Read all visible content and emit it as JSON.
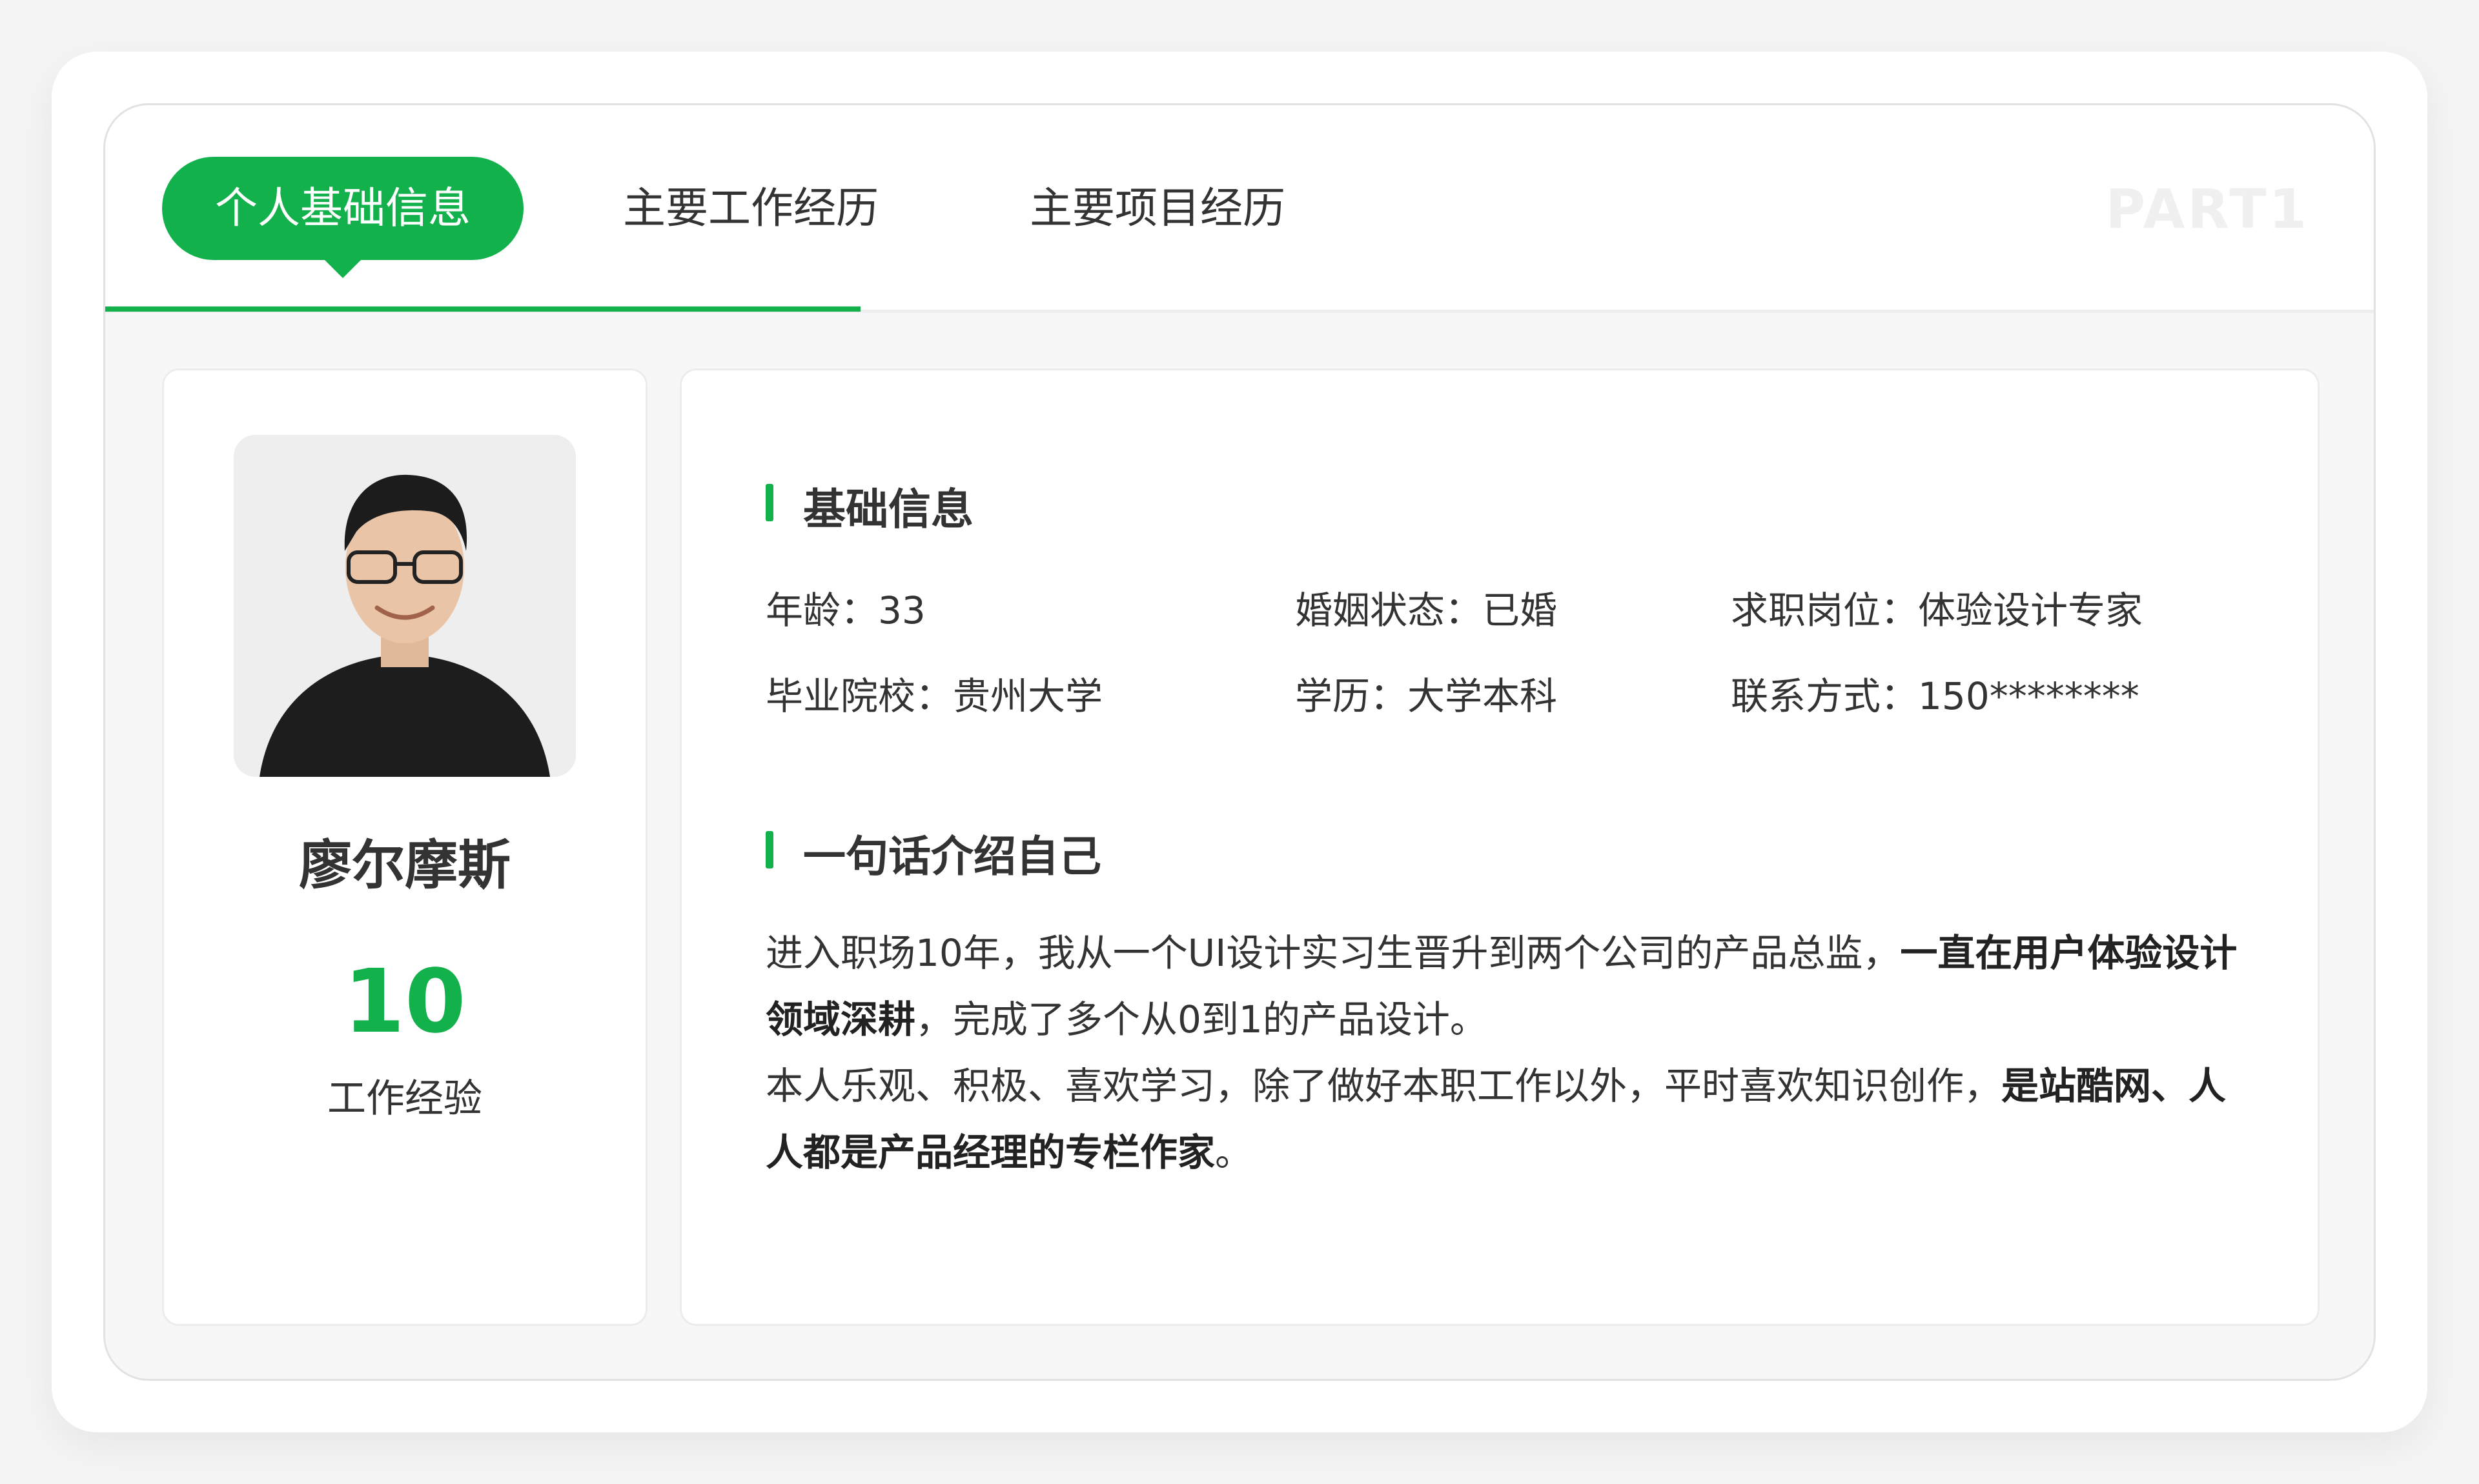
{
  "tabs": [
    {
      "label": "个人基础信息",
      "active": true
    },
    {
      "label": "主要工作经历",
      "active": false
    },
    {
      "label": "主要项目经历",
      "active": false
    }
  ],
  "part_label": "PART1",
  "profile": {
    "name": "廖尔摩斯",
    "years": "10",
    "years_label": "工作经验"
  },
  "basic_info": {
    "title": "基础信息",
    "items": [
      {
        "label": "年龄：",
        "value": "33"
      },
      {
        "label": "婚姻状态：",
        "value": "已婚"
      },
      {
        "label": "求职岗位：",
        "value": "体验设计专家"
      },
      {
        "label": "毕业院校：",
        "value": "贵州大学"
      },
      {
        "label": "学历：",
        "value": "大学本科"
      },
      {
        "label": "联系方式：",
        "value": "150********"
      }
    ]
  },
  "intro": {
    "title": "一句话介绍自己",
    "p1_normal": "进入职场10年，我从一个UI设计实习生晋升到两个公司的产品总监，",
    "p1_bold": "一直在用户体验设计领域深耕",
    "p1_tail": "，完成了多个从0到1的产品设计。",
    "p2_normal": "本人乐观、积极、喜欢学习，除了做好本职工作以外，平时喜欢知识创作，",
    "p2_bold": "是站酷网、人人都是产品经理的专栏作家",
    "p2_tail": "。"
  },
  "colors": {
    "accent": "#12b14c",
    "text": "#333333",
    "muted": "#f0f0f0"
  }
}
